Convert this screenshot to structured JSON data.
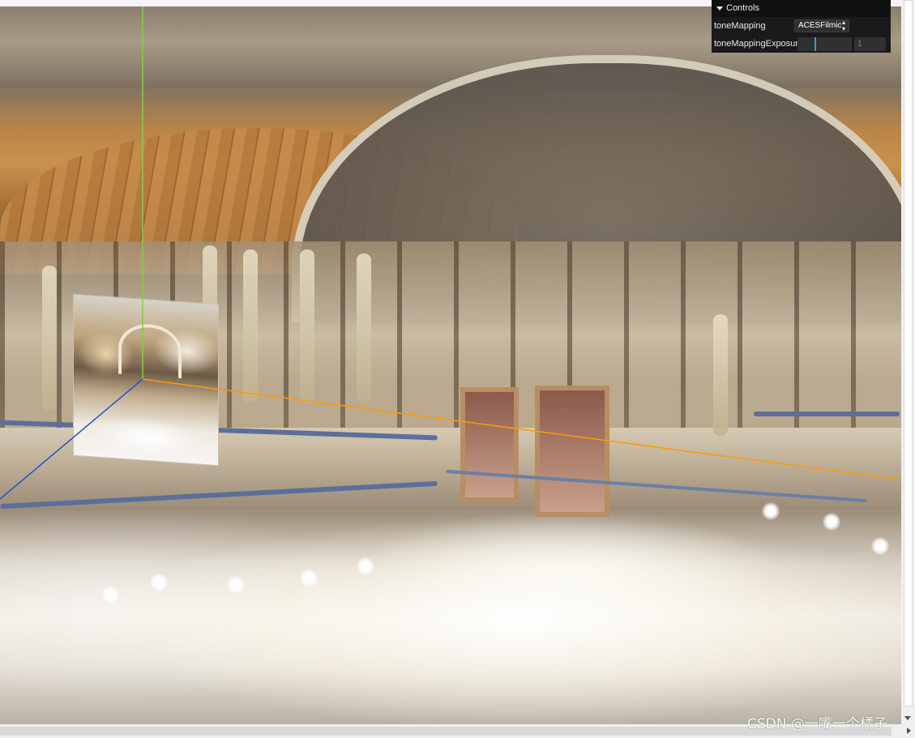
{
  "gui": {
    "title": "Controls",
    "collapse_icon": "chevron-down-icon",
    "controls": [
      {
        "label": "toneMapping",
        "type": "select",
        "value": "ACESFilmic"
      },
      {
        "label": "toneMappingExposure",
        "type": "slider",
        "value": "1",
        "slider_fraction": 0.33
      }
    ]
  },
  "scene": {
    "axes_colors": {
      "x": "#ff9900",
      "y": "#88cc44",
      "z": "#2255cc"
    }
  },
  "watermark": "CSDN @一嘴一个橘子"
}
